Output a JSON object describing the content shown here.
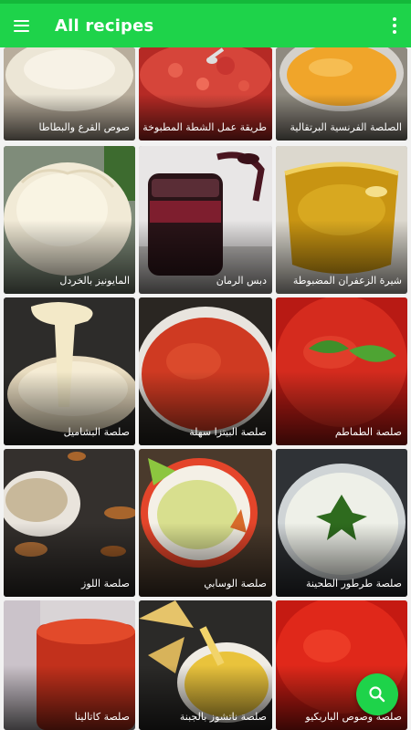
{
  "app_bar": {
    "title": "All recipes",
    "menu_icon": "hamburger-menu-icon",
    "overflow_icon": "more-vert-icon",
    "color": "#1ed34a"
  },
  "recipes": [
    {
      "name": "صوص القرع والبطاطا"
    },
    {
      "name": "طريقة عمل الشطة المطبوخة"
    },
    {
      "name": "الصلصة الفرنسية البرتقالية"
    },
    {
      "name": "المايونيز بالخردل"
    },
    {
      "name": "دبس الرمان"
    },
    {
      "name": "شيرة الزعفران المضبوطة"
    },
    {
      "name": "صلصة البشاميل"
    },
    {
      "name": "صلصة البيتزا سهلة"
    },
    {
      "name": "صلصة الطماطم"
    },
    {
      "name": "صلصة اللوز"
    },
    {
      "name": "صلصة الوسابي"
    },
    {
      "name": "صلصة طرطور الطحينة"
    },
    {
      "name": "صلصة كاتالينا"
    },
    {
      "name": "صلصة ناتشوز بالجبنة"
    },
    {
      "name": "صلصة وصوص الباربكيو"
    }
  ],
  "fab": {
    "icon": "search-icon"
  }
}
